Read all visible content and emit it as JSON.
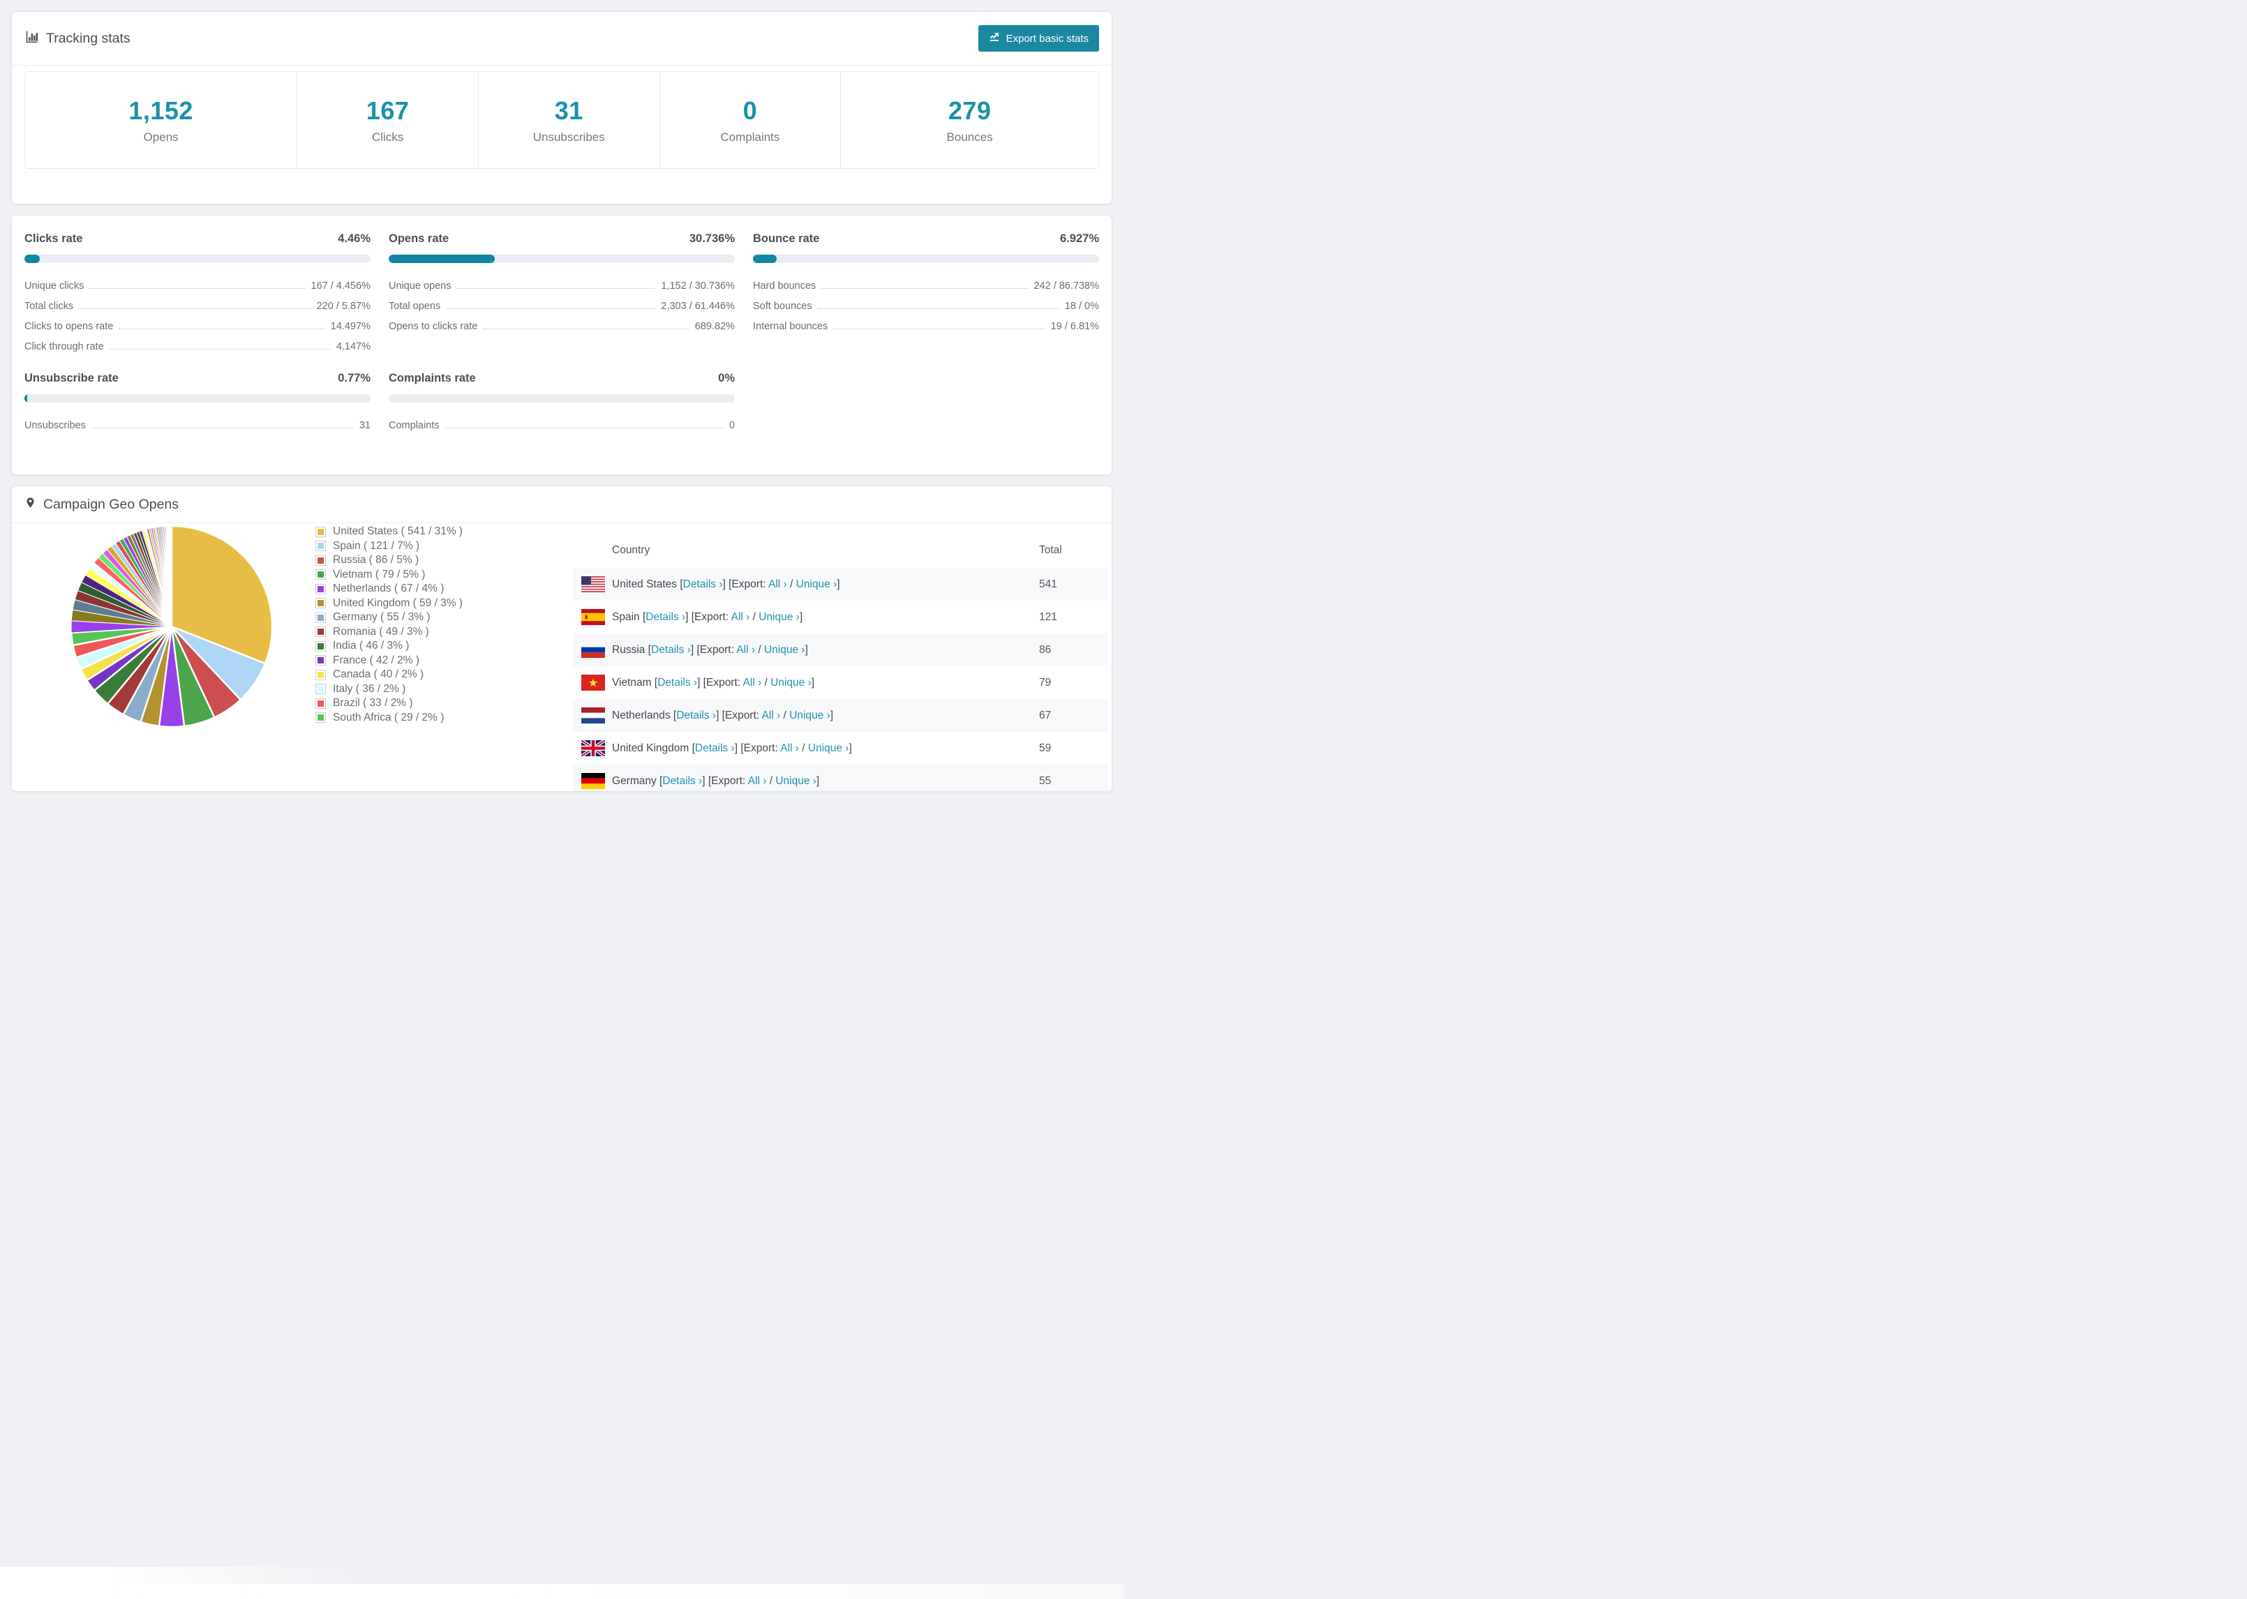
{
  "colors": {
    "accent_teal": "#1b91aa",
    "button_teal": "#1b87a0",
    "link_teal": "#2293ae",
    "bar_fill": "#0f87a2",
    "bar_track": "#e9ecf0",
    "page_bg": "#eef0f3"
  },
  "tracking": {
    "title": "Tracking stats",
    "export_label": "Export basic stats",
    "tiles": [
      {
        "value": "1,152",
        "label": "Opens"
      },
      {
        "value": "167",
        "label": "Clicks"
      },
      {
        "value": "31",
        "label": "Unsubscribes"
      },
      {
        "value": "0",
        "label": "Complaints"
      },
      {
        "value": "279",
        "label": "Bounces"
      }
    ]
  },
  "rates": {
    "blocks": [
      {
        "title": "Clicks rate",
        "value": "4.46%",
        "pct": 4.46,
        "rows": [
          {
            "label": "Unique clicks",
            "value": "167 / 4.456%"
          },
          {
            "label": "Total clicks",
            "value": "220 / 5.87%"
          },
          {
            "label": "Clicks to opens rate",
            "value": "14.497%"
          },
          {
            "label": "Click through rate",
            "value": "4.147%"
          }
        ]
      },
      {
        "title": "Opens rate",
        "value": "30.736%",
        "pct": 30.736,
        "rows": [
          {
            "label": "Unique opens",
            "value": "1,152 / 30.736%"
          },
          {
            "label": "Total opens",
            "value": "2,303 / 61.446%"
          },
          {
            "label": "Opens to clicks rate",
            "value": "689.82%"
          }
        ]
      },
      {
        "title": "Bounce rate",
        "value": "6.927%",
        "pct": 6.927,
        "rows": [
          {
            "label": "Hard bounces",
            "value": "242 / 86.738%"
          },
          {
            "label": "Soft bounces",
            "value": "18 / 0%"
          },
          {
            "label": "Internal bounces",
            "value": "19 / 6.81%"
          }
        ]
      },
      {
        "title": "Unsubscribe rate",
        "value": "0.77%",
        "pct": 0.77,
        "rows": [
          {
            "label": "Unsubscribes",
            "value": "31"
          }
        ]
      },
      {
        "title": "Complaints rate",
        "value": "0%",
        "pct": 0,
        "rows": [
          {
            "label": "Complaints",
            "value": "0"
          }
        ]
      }
    ]
  },
  "geo": {
    "title": "Campaign Geo Opens",
    "table": {
      "headers": [
        "Country",
        "Total"
      ],
      "details_label": "Details ›",
      "export_prefix": "Export:",
      "all_label": "All ›",
      "unique_label": "Unique ›",
      "rows": [
        {
          "country": "United States",
          "flag": "us",
          "total": "541"
        },
        {
          "country": "Spain",
          "flag": "es",
          "total": "121"
        },
        {
          "country": "Russia",
          "flag": "ru",
          "total": "86"
        },
        {
          "country": "Vietnam",
          "flag": "vn",
          "total": "79"
        },
        {
          "country": "Netherlands",
          "flag": "nl",
          "total": "67"
        },
        {
          "country": "United Kingdom",
          "flag": "gb",
          "total": "59"
        },
        {
          "country": "Germany",
          "flag": "de",
          "total": "55"
        }
      ]
    }
  },
  "chart_data": {
    "type": "pie",
    "title": "Campaign Geo Opens",
    "legend_position": "right",
    "unit": "opens",
    "slices": [
      {
        "label": "United States",
        "count": 541,
        "pct": 31,
        "color": "#e8bd45"
      },
      {
        "label": "Spain",
        "count": 121,
        "pct": 7,
        "color": "#aed7f5"
      },
      {
        "label": "Russia",
        "count": 86,
        "pct": 5,
        "color": "#cc4e4e"
      },
      {
        "label": "Vietnam",
        "count": 79,
        "pct": 5,
        "color": "#4ba64b"
      },
      {
        "label": "Netherlands",
        "count": 67,
        "pct": 4,
        "color": "#9741e8"
      },
      {
        "label": "United Kingdom",
        "count": 59,
        "pct": 3,
        "color": "#b3922f"
      },
      {
        "label": "Germany",
        "count": 55,
        "pct": 3,
        "color": "#8bacca"
      },
      {
        "label": "Romania",
        "count": 49,
        "pct": 3,
        "color": "#a43a3a"
      },
      {
        "label": "India",
        "count": 46,
        "pct": 3,
        "color": "#3a7d3a"
      },
      {
        "label": "France",
        "count": 42,
        "pct": 2,
        "color": "#7737c4"
      },
      {
        "label": "Canada",
        "count": 40,
        "pct": 2,
        "color": "#f7e14b"
      },
      {
        "label": "Italy",
        "count": 36,
        "pct": 2,
        "color": "#cffcfc"
      },
      {
        "label": "Brazil",
        "count": 33,
        "pct": 2,
        "color": "#f25757"
      },
      {
        "label": "South Africa",
        "count": 29,
        "pct": 2,
        "color": "#57c457"
      }
    ],
    "others": {
      "pct": 26,
      "note": "long tail of many small unlabeled country slices"
    }
  }
}
